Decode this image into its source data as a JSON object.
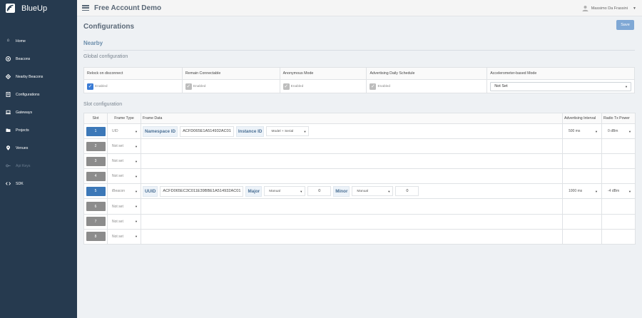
{
  "brand": {
    "name": "BlueUp",
    "logo_icon": "blueup-logo-icon"
  },
  "sidebar": {
    "items": [
      {
        "label": "Home",
        "icon": "home-icon"
      },
      {
        "label": "Beacons",
        "icon": "beacon-icon"
      },
      {
        "label": "Nearby Beacons",
        "icon": "nearby-icon"
      },
      {
        "label": "Configurations",
        "icon": "document-icon"
      },
      {
        "label": "Gateways",
        "icon": "laptop-icon"
      },
      {
        "label": "Projects",
        "icon": "folder-icon"
      },
      {
        "label": "Venues",
        "icon": "map-marker-icon"
      },
      {
        "label": "Api Keys",
        "icon": "key-icon",
        "disabled": true
      },
      {
        "label": "SDK",
        "icon": "code-icon"
      }
    ]
  },
  "header": {
    "title": "Free Account Demo",
    "user_name": "Massimo Da Frassini"
  },
  "page": {
    "title": "Configurations",
    "save_label": "Save",
    "section": "Nearby",
    "global_title": "Global configuration",
    "slot_title": "Slot configuration"
  },
  "global_config": {
    "columns": [
      {
        "label": "Relock on disconnect",
        "kind": "checkbox",
        "checked": true,
        "value": "Enabled"
      },
      {
        "label": "Remain Connectable",
        "kind": "checkbox",
        "checked": false,
        "value": "Enabled"
      },
      {
        "label": "Anonymous Mode",
        "kind": "checkbox",
        "checked": false,
        "value": "Enabled"
      },
      {
        "label": "Advertising Daily Schedule",
        "kind": "checkbox",
        "checked": false,
        "value": "Enabled"
      },
      {
        "label": "Accelerometer-based Mode",
        "kind": "select",
        "value": "Not Set"
      }
    ]
  },
  "slot_config": {
    "headers": {
      "slot": "Slot",
      "frame_type": "Frame Type",
      "frame_data": "Frame Data",
      "interval": "Advertising Interval",
      "power": "Radio Tx Power"
    },
    "rows": [
      {
        "slot": "1",
        "active": true,
        "frame_type": "UID",
        "fields": [
          {
            "kind": "label",
            "text": "Namespace ID"
          },
          {
            "kind": "input",
            "text": "ACFD065E1A514932AC01"
          },
          {
            "kind": "label",
            "text": "Instance ID"
          },
          {
            "kind": "select",
            "text": "Model + Serial"
          }
        ],
        "interval": "500 ms",
        "power": "0 dBm"
      },
      {
        "slot": "2",
        "active": false,
        "frame_type": "Not set",
        "fields": [],
        "interval": "",
        "power": ""
      },
      {
        "slot": "3",
        "active": false,
        "frame_type": "Not set",
        "fields": [],
        "interval": "",
        "power": ""
      },
      {
        "slot": "4",
        "active": false,
        "frame_type": "Not set",
        "fields": [],
        "interval": "",
        "power": ""
      },
      {
        "slot": "5",
        "active": true,
        "frame_type": "iBeacon",
        "fields": [
          {
            "kind": "label",
            "text": "UUID"
          },
          {
            "kind": "input",
            "text": "ACFD065EC3C011E39BBE1A514932AC01"
          },
          {
            "kind": "label",
            "text": "Major"
          },
          {
            "kind": "select",
            "text": "Manual"
          },
          {
            "kind": "number",
            "text": "0"
          },
          {
            "kind": "label",
            "text": "Minor"
          },
          {
            "kind": "select",
            "text": "Manual"
          },
          {
            "kind": "number",
            "text": "0"
          }
        ],
        "interval": "1000 ms",
        "power": "-4 dBm"
      },
      {
        "slot": "6",
        "active": false,
        "frame_type": "Not set",
        "fields": [],
        "interval": "",
        "power": ""
      },
      {
        "slot": "7",
        "active": false,
        "frame_type": "Not set",
        "fields": [],
        "interval": "",
        "power": ""
      },
      {
        "slot": "8",
        "active": false,
        "frame_type": "Not set",
        "fields": [],
        "interval": "",
        "power": ""
      }
    ]
  },
  "colors": {
    "sidebar_bg": "#263a4f",
    "accent": "#3c78b8",
    "save_button": "#7fa8d5",
    "section_title": "#6b8dab"
  }
}
